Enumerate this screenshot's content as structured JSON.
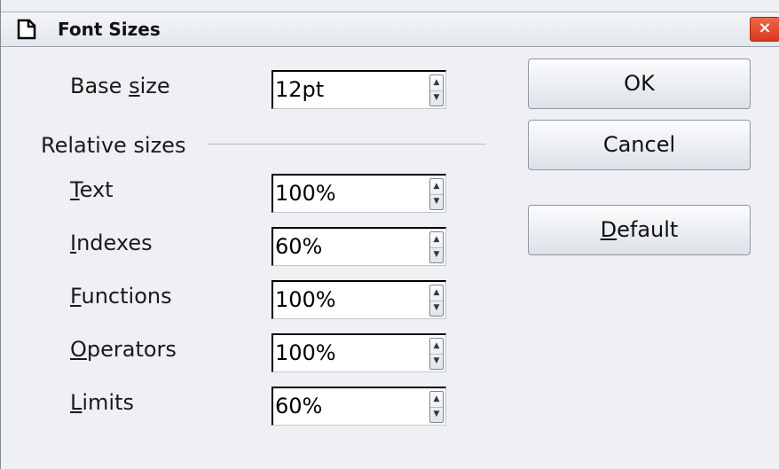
{
  "window": {
    "title": "Font Sizes",
    "close_symbol": "×",
    "title_icon": "document-icon"
  },
  "base_size": {
    "label_access": "s",
    "label_pre": "Base ",
    "label_post": "ize",
    "value": "12pt"
  },
  "relative_sizes": {
    "heading": "Relative sizes",
    "items": [
      {
        "access": "T",
        "rest": "ext",
        "value": "100%"
      },
      {
        "access": "I",
        "rest": "ndexes",
        "value": "60%"
      },
      {
        "access": "F",
        "rest": "unctions",
        "value": "100%"
      },
      {
        "access": "O",
        "rest": "perators",
        "value": "100%"
      },
      {
        "access": "L",
        "rest": "imits",
        "value": "60%"
      }
    ]
  },
  "buttons": {
    "ok": "OK",
    "cancel": "Cancel",
    "default_access": "D",
    "default_rest": "efault"
  },
  "icons": {
    "spin_up": "▲",
    "spin_down": "▼"
  }
}
